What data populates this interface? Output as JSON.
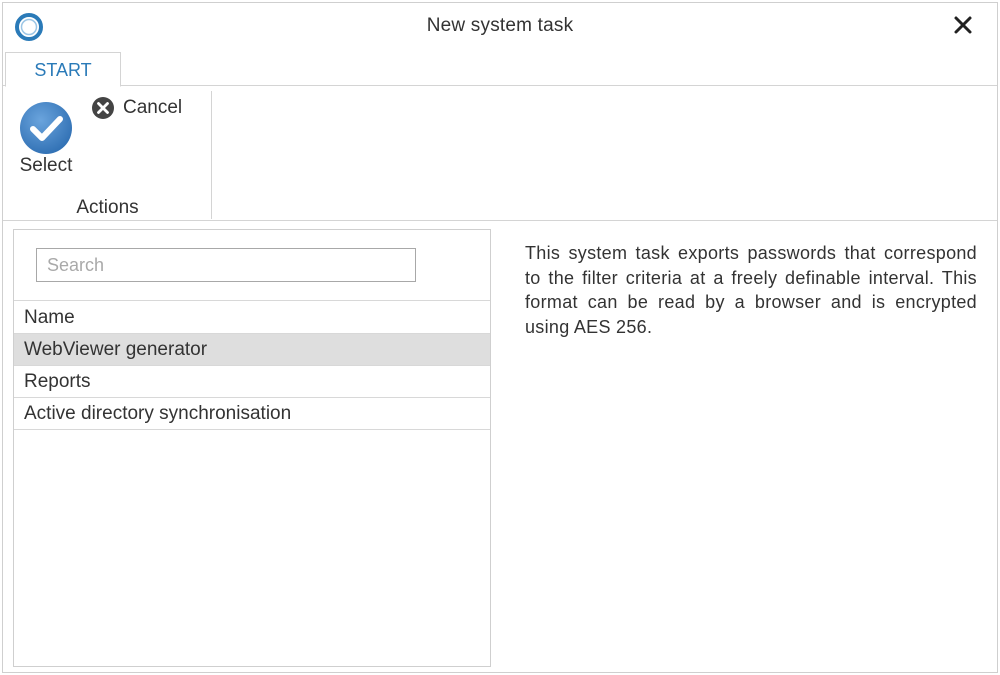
{
  "window": {
    "title": "New system task"
  },
  "ribbon": {
    "tabs": [
      {
        "label": "START",
        "active": true
      }
    ],
    "groups": [
      {
        "label": "Actions",
        "buttons": [
          {
            "label": "Select",
            "icon": "checkmark-circle-icon"
          },
          {
            "label": "Cancel",
            "icon": "close-circle-icon"
          }
        ]
      }
    ]
  },
  "task_list": {
    "search_placeholder": "Search",
    "search_value": "",
    "column_header": "Name",
    "items": [
      {
        "label": "WebViewer generator",
        "selected": true
      },
      {
        "label": "Reports",
        "selected": false
      },
      {
        "label": "Active directory synchronisation",
        "selected": false
      }
    ]
  },
  "description": "This system task exports passwords that correspond to the filter criteria at a freely definable interval. This format can be read by a browser and is encrypted using AES 256.",
  "colors": {
    "accent": "#2a7ab8",
    "select_icon": "#3b7fc4",
    "selected_row": "#dedede"
  }
}
